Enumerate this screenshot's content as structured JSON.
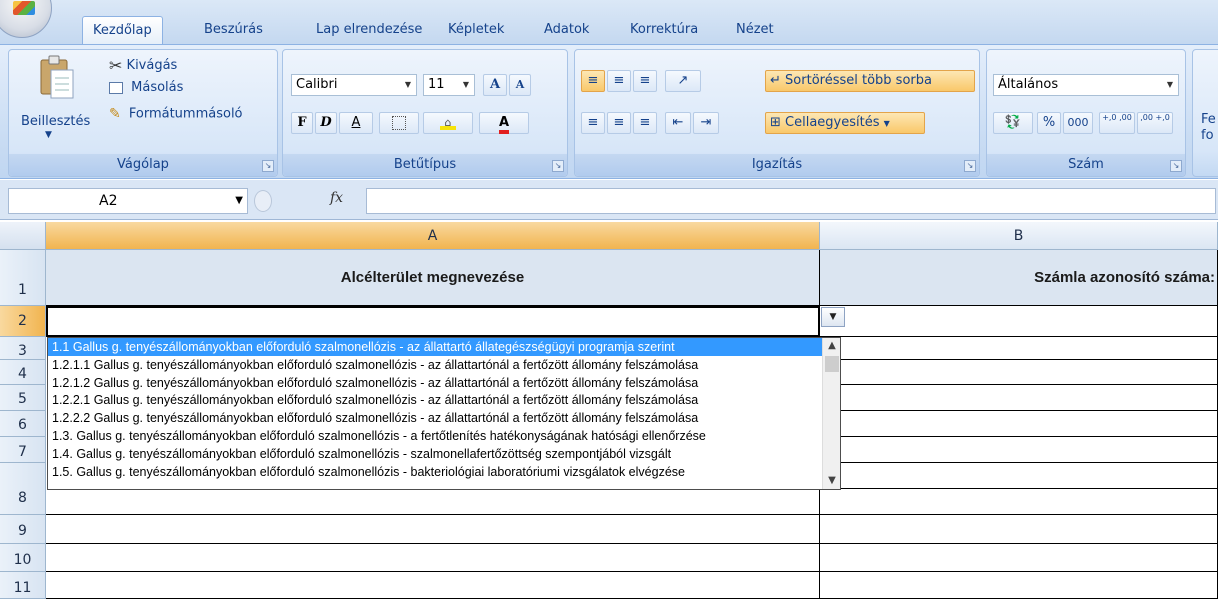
{
  "tabs": [
    "Kezdőlap",
    "Beszúrás",
    "Lap elrendezése",
    "Képletek",
    "Adatok",
    "Korrektúra",
    "Nézet"
  ],
  "clipboard": {
    "paste_label": "Beillesztés",
    "cut_label": "Kivágás",
    "copy_label": "Másolás",
    "format_painter_label": "Formátummásoló",
    "group_label": "Vágólap"
  },
  "font": {
    "font_name": "Calibri",
    "font_size": "11",
    "bold": "F",
    "italic": "D",
    "underline": "A",
    "font_color": "A",
    "grow": "A",
    "shrink": "A",
    "group_label": "Betűtípus"
  },
  "alignment": {
    "wrap_text_label": "Sortöréssel több sorba",
    "merge_label": "Cellaegyesítés",
    "group_label": "Igazítás"
  },
  "number": {
    "format": "Általános",
    "percent": "%",
    "thousands": "000",
    "inc_decimal": "+,0 ,00",
    "dec_decimal": ",00 +,0",
    "group_label": "Szám"
  },
  "styles": {
    "partial_label": "Fe fo"
  },
  "formula_bar": {
    "name_box": "A2",
    "fx": "fx",
    "formula": ""
  },
  "grid": {
    "columns": [
      "A",
      "B"
    ],
    "rows": [
      "1",
      "2",
      "3",
      "4",
      "5",
      "6",
      "7",
      "8",
      "9",
      "10",
      "11"
    ],
    "header_a": "Alcélterület megnevezése",
    "header_b": "Számla azonosító száma:"
  },
  "dropdown": {
    "items": [
      "1.1 Gallus g. tenyészállományokban előforduló szalmonellózis - az állattartó állategészségügyi programja szerint",
      "1.2.1.1 Gallus g. tenyészállományokban előforduló szalmonellózis - az állattartónál a fertőzött állomány felszámolása",
      "1.2.1.2 Gallus g. tenyészállományokban előforduló szalmonellózis - az állattartónál a fertőzött állomány felszámolása",
      "1.2.2.1 Gallus g. tenyészállományokban előforduló szalmonellózis - az állattartónál a fertőzött állomány felszámolása",
      "1.2.2.2 Gallus g. tenyészállományokban előforduló szalmonellózis - az állattartónál a fertőzött állomány felszámolása",
      "1.3. Gallus g. tenyészállományokban előforduló szalmonellózis - a fertőtlenítés hatékonyságának hatósági ellenőrzése",
      "1.4. Gallus g. tenyészállományokban előforduló szalmonellózis - szalmonellafertőzöttség szempontjából vizsgált",
      "1.5. Gallus g. tenyészállományokban előforduló szalmonellózis - bakteriológiai laboratóriumi vizsgálatok elvégzése"
    ],
    "selected_index": 0
  }
}
